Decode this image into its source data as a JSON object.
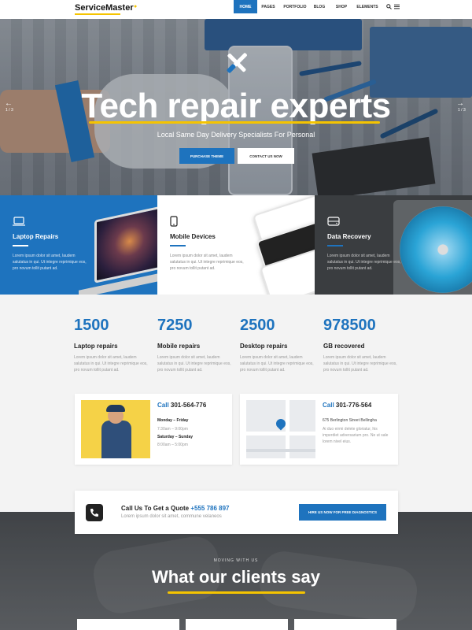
{
  "nav": {
    "logo": "ServiceMaster",
    "items": [
      "HOME",
      "PAGES",
      "PORTFOLIO",
      "BLOG",
      "SHOP",
      "ELEMENTS"
    ],
    "active": "HOME",
    "icons": [
      "search-icon",
      "menu-icon"
    ]
  },
  "hero": {
    "title": "Tech repair experts",
    "subtitle": "Local Same Day Delivery Specialists For Personal",
    "primary_button": "PURCHASE THEME",
    "secondary_button": "CONTACT US NOW",
    "slide_counter_left": "1 / 3",
    "slide_counter_right": "1 / 3",
    "accent": "#1e73be",
    "highlight": "#f5c400"
  },
  "services": [
    {
      "title": "Laptop Repairs",
      "icon": "laptop-icon",
      "text": "Lorem ipsum dolor sit amet, laudem salutatus in qui. Ut integre reprimique eos, pro novum tollit putant ad."
    },
    {
      "title": "Mobile Devices",
      "icon": "mobile-icon",
      "text": "Lorem ipsum dolor sit amet, laudem salutatus in qui. Ut integre reprimique eos, pro novum tollit putant ad."
    },
    {
      "title": "Data Recovery",
      "icon": "hard-drive-icon",
      "text": "Lorem ipsum dolor sit amet, laudem salutatus in qui. Ut integre reprimique eos, pro novum tollit putant ad."
    }
  ],
  "stats": [
    {
      "value": "1500",
      "label": "Laptop repairs",
      "text": "Lorem ipsum dolor sit amet, laudem salutatus in qui. Ut integre reprimique eos, pro novum tollit putant ad."
    },
    {
      "value": "7250",
      "label": "Mobile repairs",
      "text": "Lorem ipsum dolor sit amet, laudem salutatus in qui. Ut integre reprimique eos, pro novum tollit putant ad."
    },
    {
      "value": "2500",
      "label": "Desktop repairs",
      "text": "Lorem ipsum dolor sit amet, laudem salutatus in qui. Ut integre reprimique eos, pro novum tollit putant ad."
    },
    {
      "value": "978500",
      "label": "GB recovered",
      "text": "Lorem ipsum dolor sit amet, laudem salutatus in qui. Ut integre reprimique eos, pro novum tollit putant ad."
    }
  ],
  "contact_left": {
    "call_label": "Call",
    "phone": "301-564-776",
    "line1": "Monday – Friday",
    "line2": "7:30am – 9:00pm",
    "line3": "Saturday – Sunday",
    "line4": "8:00am – 5:00pm"
  },
  "contact_right": {
    "call_label": "Call",
    "phone": "301-776-564",
    "line1": "675 Berlington Street Bellingha",
    "line2": "Ai duo eirmi delete gloriatur, his",
    "line3": "imperdiet adversarium pro. Ne ut sale",
    "line4": "lorem nivel eius."
  },
  "quote": {
    "title": "Call Us To Get a Quote",
    "phone": "+555 786 897",
    "subtitle": "Lorem ipsum dolor sit amet, commune velaneos",
    "button": "HIRE US NOW FOR FREE DIAGNOSTICS"
  },
  "testimonials": {
    "overline": "MOVING WITH US",
    "title": "What our clients say"
  }
}
